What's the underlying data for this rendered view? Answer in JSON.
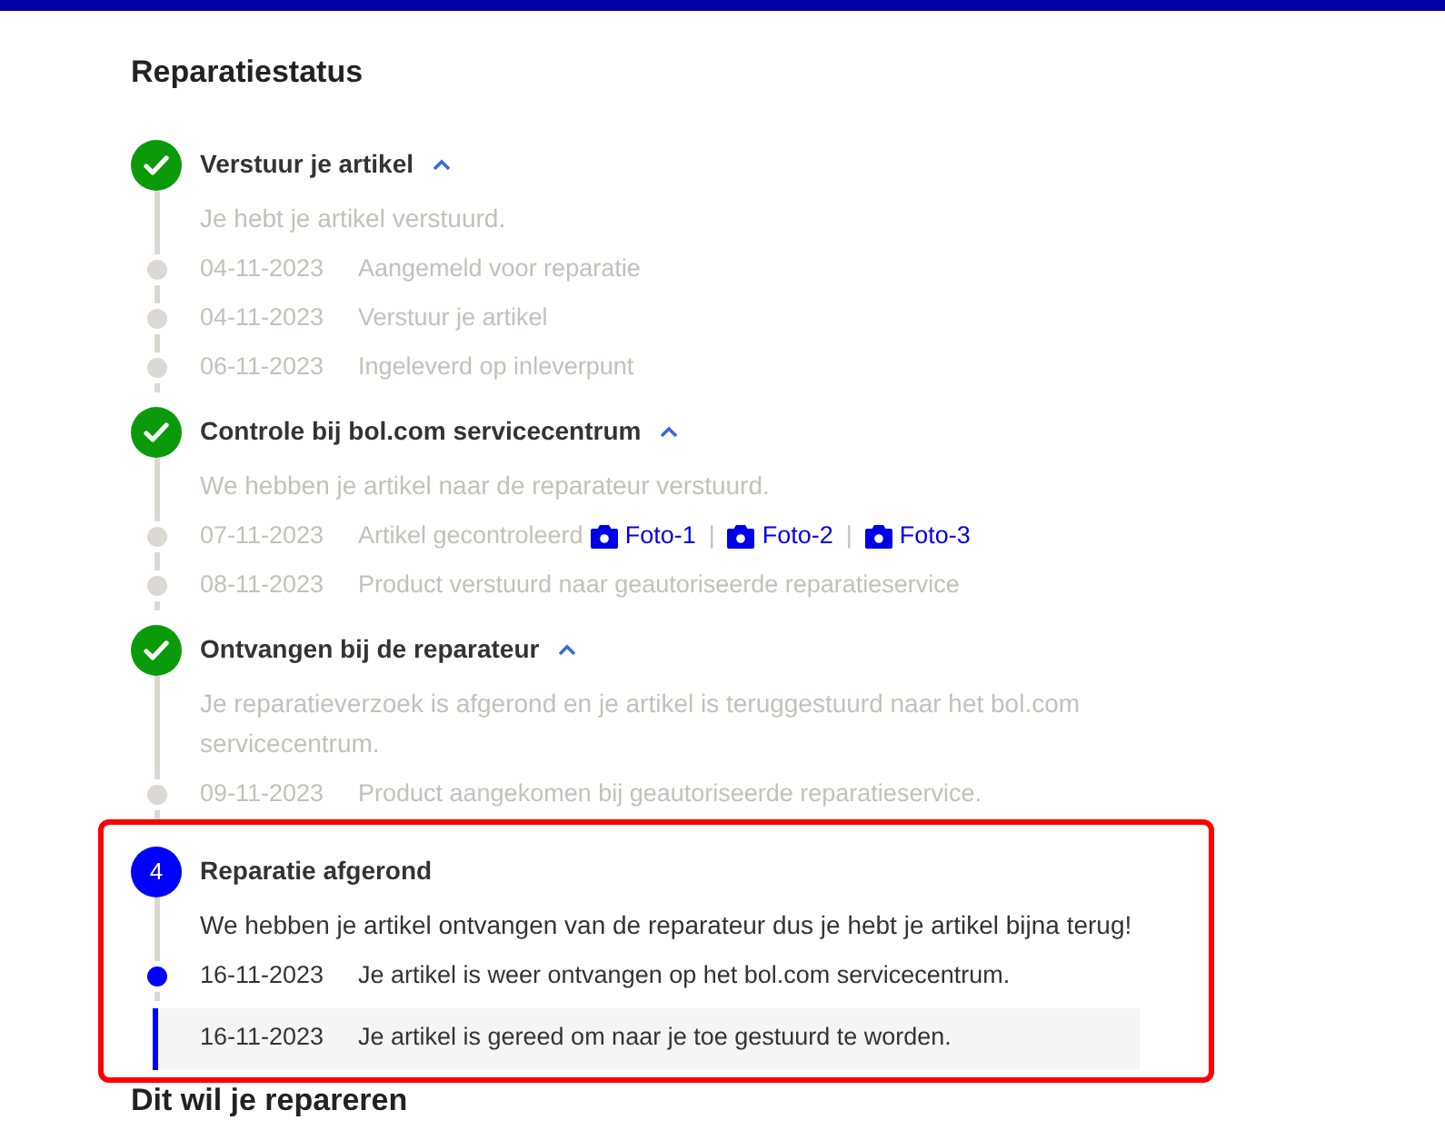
{
  "heading": "Reparatiestatus",
  "steps": [
    {
      "kind": "done",
      "title": "Verstuur je artikel",
      "collapsible": true,
      "expanded": true,
      "highlighted": false,
      "description": "Je hebt je artikel verstuurd.",
      "events": [
        {
          "date": "04-11-2023",
          "text": "Aangemeld voor reparatie",
          "active": false
        },
        {
          "date": "04-11-2023",
          "text": "Verstuur je artikel",
          "active": false
        },
        {
          "date": "06-11-2023",
          "text": "Ingeleverd op inleverpunt",
          "active": false
        }
      ]
    },
    {
      "kind": "done",
      "title": "Controle bij bol.com servicecentrum",
      "collapsible": true,
      "expanded": true,
      "highlighted": false,
      "description": "We hebben je artikel naar de reparateur verstuurd.",
      "events": [
        {
          "date": "07-11-2023",
          "text": "Artikel gecontroleerd",
          "active": false,
          "separator": "|",
          "links": [
            {
              "label": "Foto-1"
            },
            {
              "label": "Foto-2"
            },
            {
              "label": "Foto-3"
            }
          ]
        },
        {
          "date": "08-11-2023",
          "text": "Product verstuurd naar geautoriseerde reparatieservice",
          "active": false
        }
      ]
    },
    {
      "kind": "done",
      "title": "Ontvangen bij de reparateur",
      "collapsible": true,
      "expanded": true,
      "highlighted": false,
      "description": "Je reparatieverzoek is afgerond en je artikel is teruggestuurd naar het bol.com servicecentrum.",
      "events": [
        {
          "date": "09-11-2023",
          "text": "Product aangekomen bij geautoriseerde reparatieservice.",
          "active": false
        }
      ]
    },
    {
      "kind": "current",
      "number": "4",
      "title": "Reparatie afgerond",
      "collapsible": false,
      "highlighted": true,
      "description": "We hebben je artikel ontvangen van de reparateur dus je hebt je artikel bijna terug!",
      "events": [
        {
          "date": "16-11-2023",
          "text": "Je artikel is weer ontvangen op het bol.com servicecentrum.",
          "active": false
        },
        {
          "date": "16-11-2023",
          "text": "Je artikel is gereed om naar je toe gestuurd te worden.",
          "active": true
        }
      ]
    }
  ],
  "next_heading": "Dit wil je repareren"
}
